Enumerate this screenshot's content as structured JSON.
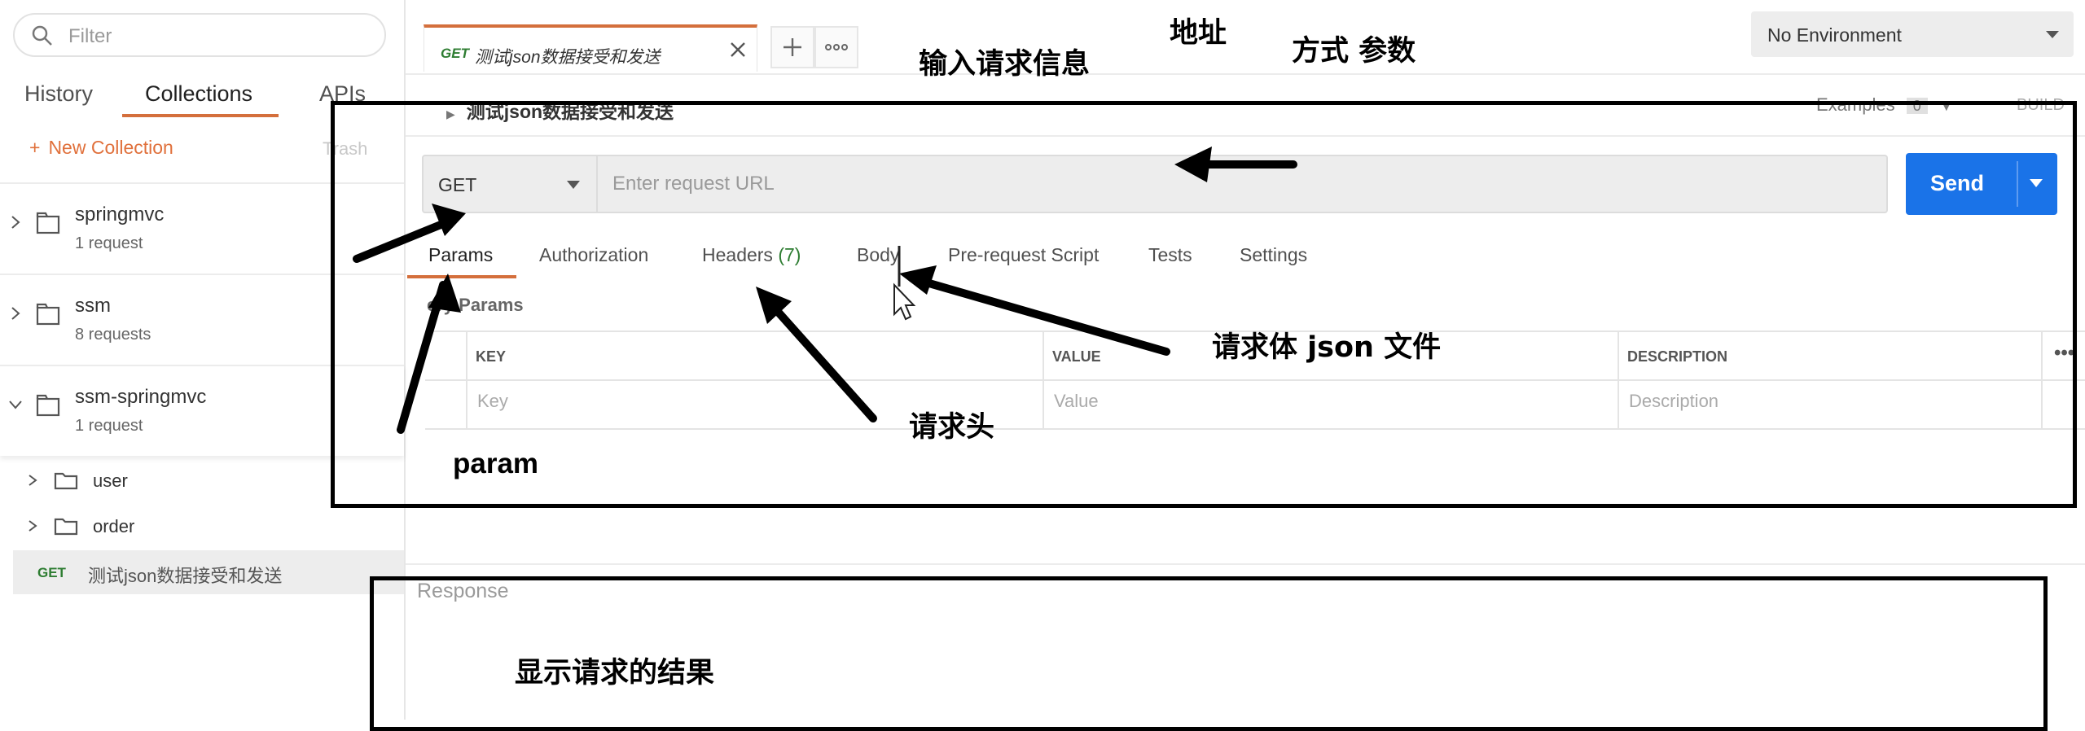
{
  "sidebar": {
    "filter_placeholder": "Filter",
    "tabs": [
      {
        "label": "History"
      },
      {
        "label": "Collections"
      },
      {
        "label": "APIs"
      }
    ],
    "new_collection": "New Collection",
    "trash": "Trash",
    "collections": [
      {
        "name": "springmvc",
        "count": "1 request"
      },
      {
        "name": "ssm",
        "count": "8 requests"
      },
      {
        "name": "ssm-springmvc",
        "count": "1 request"
      }
    ],
    "folders": [
      {
        "name": "user"
      },
      {
        "name": "order"
      }
    ],
    "request": {
      "method": "GET",
      "name": "测试json数据接受和发送"
    }
  },
  "tabbar": {
    "tab": {
      "method": "GET",
      "name": "测试json数据接受和发送"
    },
    "environment": "No Environment"
  },
  "request": {
    "breadcrumb": "测试json数据接受和发送",
    "examples": "Examples",
    "examples_count": "0",
    "build": "BUILD",
    "method": "GET",
    "url_placeholder": "Enter request URL",
    "url_value": "",
    "send": "Send",
    "tabs": [
      {
        "label": "Params"
      },
      {
        "label": "Authorization"
      },
      {
        "label": "Headers"
      },
      {
        "label": "Body"
      },
      {
        "label": "Pre-request Script"
      },
      {
        "label": "Tests"
      },
      {
        "label": "Settings"
      }
    ],
    "headers_count": "(7)",
    "query_params_title": "ery Params",
    "table": {
      "columns": [
        "KEY",
        "VALUE",
        "DESCRIPTION"
      ],
      "placeholders": [
        "Key",
        "Value",
        "Description"
      ]
    }
  },
  "response": {
    "title": "Response"
  },
  "annotations": {
    "input_info": "输入请求信息",
    "address": "地址",
    "method_params": "方式 参数",
    "body_json": "请求体  json 文件",
    "headers": "请求头",
    "param": "param",
    "show_result": "显示请求的结果"
  },
  "colors": {
    "accent": "#d46f3c",
    "send_blue": "#1a73e8",
    "get_green": "#2e7d32",
    "annotation": "#000000"
  }
}
